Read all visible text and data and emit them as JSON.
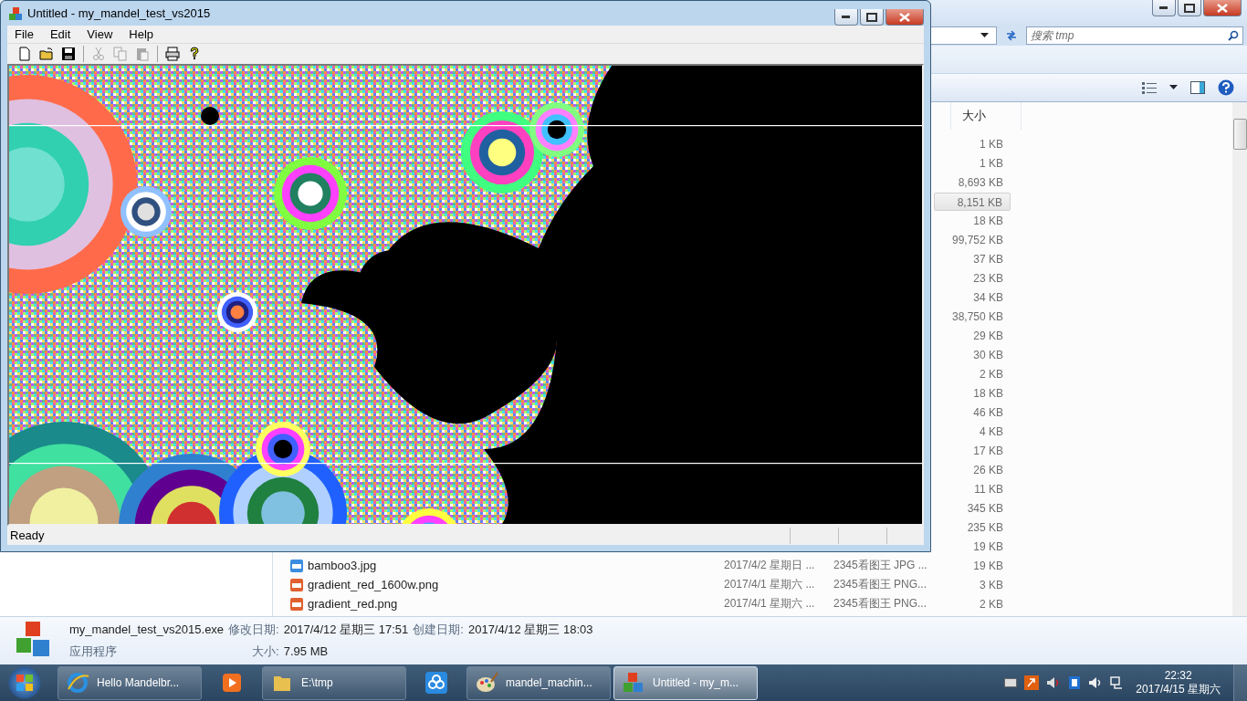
{
  "app_window": {
    "title": "Untitled - my_mandel_test_vs2015",
    "menu": [
      "File",
      "Edit",
      "View",
      "Help"
    ],
    "toolbar": [
      {
        "kind": "new",
        "disabled": false
      },
      {
        "kind": "open",
        "disabled": false
      },
      {
        "kind": "save",
        "disabled": false
      },
      {
        "kind": "cut",
        "disabled": true
      },
      {
        "kind": "copy",
        "disabled": true
      },
      {
        "kind": "paste",
        "disabled": true
      },
      {
        "kind": "print",
        "disabled": false
      },
      {
        "kind": "help",
        "disabled": false
      }
    ],
    "status": "Ready"
  },
  "explorer": {
    "search": {
      "placeholder": "搜索 tmp"
    },
    "size_column": "大小",
    "files": [
      {
        "size": "1 KB",
        "selected": false
      },
      {
        "size": "1 KB",
        "selected": false
      },
      {
        "size": "8,693 KB",
        "selected": false
      },
      {
        "size": "8,151 KB",
        "selected": true
      },
      {
        "size": "18 KB",
        "selected": false
      },
      {
        "size": "99,752 KB",
        "selected": false
      },
      {
        "size": "37 KB",
        "selected": false
      },
      {
        "size": "23 KB",
        "selected": false
      },
      {
        "size": "34 KB",
        "selected": false
      },
      {
        "size": "38,750 KB",
        "selected": false
      },
      {
        "size": "29 KB",
        "selected": false
      },
      {
        "size": "30 KB",
        "selected": false
      },
      {
        "size": "2 KB",
        "selected": false
      },
      {
        "size": "18 KB",
        "selected": false
      },
      {
        "size": "46 KB",
        "selected": false
      },
      {
        "size": "4 KB",
        "selected": false
      },
      {
        "size": "17 KB",
        "selected": false
      },
      {
        "size": "26 KB",
        "selected": false
      },
      {
        "size": "11 KB",
        "selected": false
      },
      {
        "size": "345 KB",
        "selected": false
      },
      {
        "size": "235 KB",
        "selected": false
      },
      {
        "size": "19 KB",
        "selected": false
      },
      {
        "kind": "jpg",
        "name": "bamboo3.jpg",
        "date": "2017/4/2 星期日 ...",
        "type": "2345看图王 JPG ...",
        "size": "19 KB",
        "selected": false
      },
      {
        "kind": "png",
        "name": "gradient_red_1600w.png",
        "date": "2017/4/1 星期六 ...",
        "type": "2345看图王 PNG...",
        "size": "3 KB",
        "selected": false
      },
      {
        "kind": "png",
        "name": "gradient_red.png",
        "date": "2017/4/1 星期六 ...",
        "type": "2345看图王 PNG...",
        "size": "2 KB",
        "selected": false
      }
    ],
    "details": {
      "name": "my_mandel_test_vs2015.exe",
      "modified_label": "修改日期:",
      "modified": "2017/4/12 星期三 17:51",
      "created_label": "创建日期:",
      "created": "2017/4/12 星期三 18:03",
      "type": "应用程序",
      "size_label": "大小:",
      "size": "7.95 MB"
    }
  },
  "taskbar": {
    "buttons": [
      {
        "kind": "ie",
        "label": "Hello Mandelbr...",
        "selected": false
      },
      {
        "kind": "media",
        "selected": false
      },
      {
        "kind": "folder",
        "label": "E:\\tmp",
        "selected": false
      },
      {
        "kind": "cloud",
        "selected": false
      },
      {
        "kind": "paint",
        "label": "mandel_machin...",
        "selected": false
      },
      {
        "kind": "mfc",
        "label": "Untitled - my_m...",
        "selected": true
      }
    ],
    "clock": {
      "time": "22:32",
      "date": "2017/4/15 星期六"
    }
  }
}
